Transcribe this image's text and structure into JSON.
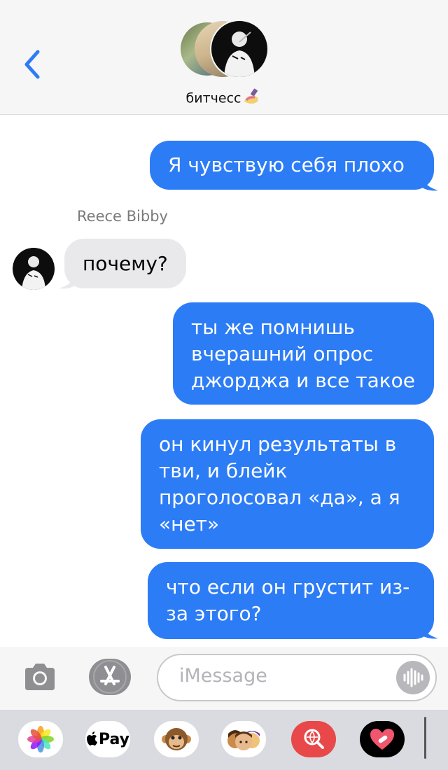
{
  "header": {
    "group_name": "битчесс",
    "name_emoji": "nail-polish-icon",
    "back_icon": "chevron-left-icon",
    "accent": "#2c7cf6"
  },
  "messages": [
    {
      "from": "me",
      "text": "Я чувствую себя плохо"
    },
    {
      "from": "Reece Bibby",
      "sender_label": "Reece Bibby",
      "text": "почему?"
    },
    {
      "from": "me",
      "lines": [
        "ты же помнишь",
        "вчерашний опрос",
        "джорджа и все такое"
      ]
    },
    {
      "from": "me",
      "lines": [
        "он кинул результаты в",
        "тви, и блейк",
        "проголосовал «да», а я",
        "«нет»"
      ]
    },
    {
      "from": "me",
      "lines": [
        "что если он грустит из-",
        "за этого?"
      ]
    }
  ],
  "input": {
    "placeholder": "iMessage",
    "camera_icon": "camera-icon",
    "apps_icon": "app-store-icon",
    "voice_icon": "audio-waveform-icon"
  },
  "app_drawer": {
    "items": [
      {
        "name": "photos-app-icon"
      },
      {
        "name": "apple-pay-icon",
        "label": "Pay"
      },
      {
        "name": "animoji-monkey-icon"
      },
      {
        "name": "memoji-stickers-icon"
      },
      {
        "name": "image-search-icon"
      },
      {
        "name": "digital-touch-heart-icon"
      }
    ]
  },
  "colors": {
    "outgoing_bubble": "#2c7cf6",
    "incoming_bubble": "#e9e9eb",
    "header_bg": "#f6f6f6",
    "drawer_bg": "#d9dbe0"
  }
}
